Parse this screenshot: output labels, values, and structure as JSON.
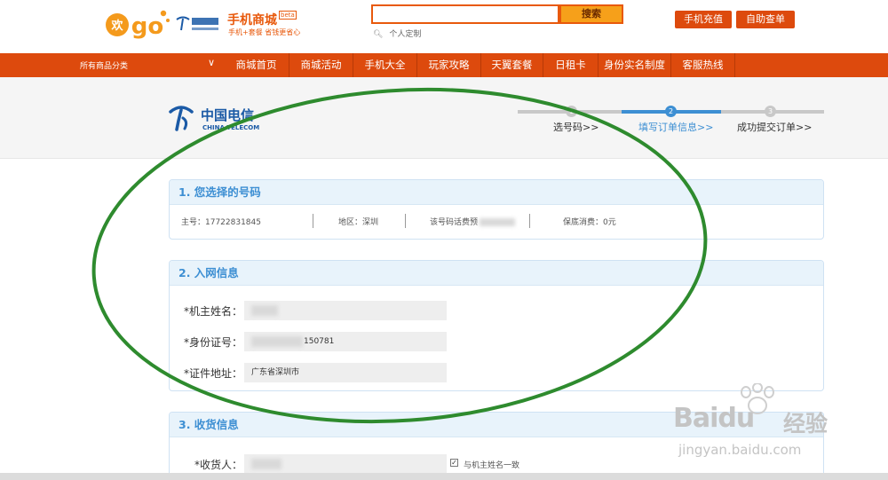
{
  "header": {
    "mall_title": "手机商城",
    "beta": "beta",
    "slogan": "手机+套餐 省钱更省心",
    "search_button": "搜索",
    "search_value": "",
    "custom_link": "个人定制",
    "recharge_button": "手机充值",
    "query_button": "自助查单"
  },
  "nav": {
    "all_categories": "所有商品分类",
    "items": [
      {
        "label": "商城首页"
      },
      {
        "label": "商城活动"
      },
      {
        "label": "手机大全"
      },
      {
        "label": "玩家攻略"
      },
      {
        "label": "天翼套餐"
      },
      {
        "label": "日租卡"
      },
      {
        "label": "身份实名制度"
      },
      {
        "label": "客服热线"
      }
    ]
  },
  "brand": {
    "ct_name_cn": "中国电信",
    "ct_name_en": "CHINA TELECOM"
  },
  "steps": {
    "items": [
      {
        "num": "1",
        "label": "选号码>>",
        "active": false
      },
      {
        "num": "2",
        "label": "填写订单信息>>",
        "active": true
      },
      {
        "num": "3",
        "label": "成功提交订单>>",
        "active": false
      }
    ],
    "colors": {
      "active": "#3d8fd3",
      "inactive": "#c8c8c8"
    }
  },
  "section1": {
    "title": "1. 您选择的号码",
    "main_number": "主号：17722831845",
    "region": "地区：深圳",
    "fee_label": "该号码话费预",
    "min_consumption": "保底消费：0元"
  },
  "section2": {
    "title": "2. 入网信息",
    "name_label": "*机主姓名：",
    "id_label": "*身份证号：",
    "id_partial": "150781",
    "address_label": "*证件地址：",
    "address_value": "广东省深圳市"
  },
  "section3": {
    "title": "3. 收货信息",
    "receiver_label": "*收货人：",
    "same_as_owner_label": "与机主姓名一致",
    "same_as_owner_checked": true
  },
  "watermark": {
    "brand": "Baidu",
    "cn": "经验",
    "url": "jingyan.baidu.com"
  },
  "colors": {
    "brand_orange": "#dd4a0d",
    "panel_title_blue": "#3d8fd3",
    "annotation_green": "#2e8b2e"
  }
}
